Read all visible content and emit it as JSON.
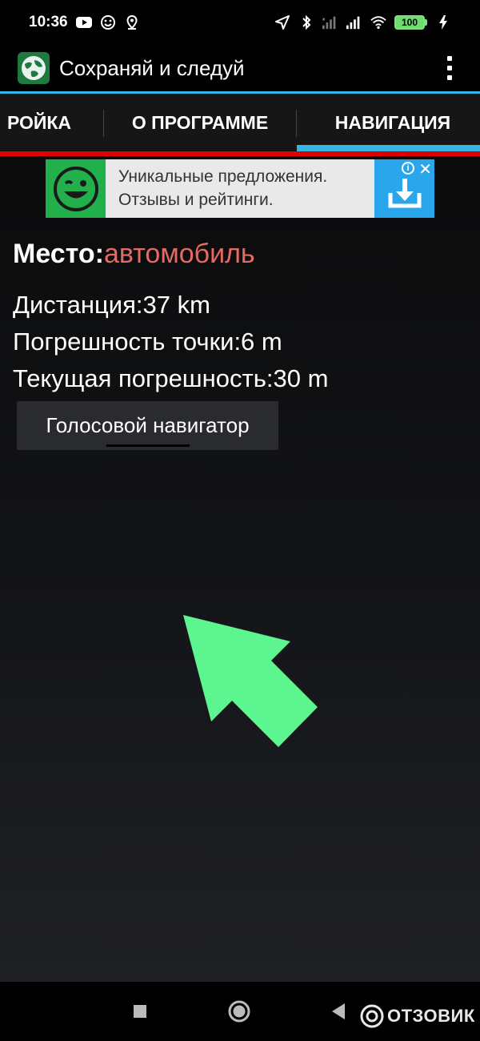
{
  "status_bar": {
    "time": "10:36",
    "battery": "100"
  },
  "app": {
    "title": "Сохраняй и следуй"
  },
  "tabs": [
    {
      "label": "РОЙКА"
    },
    {
      "label": "О ПРОГРАММЕ"
    },
    {
      "label": "НАВИГАЦИЯ",
      "selected": true
    }
  ],
  "ad": {
    "line1": "Уникальные предложения.",
    "line2": "Отзывы и рейтинги."
  },
  "place": {
    "label": "Место:",
    "value": "автомобиль"
  },
  "info": {
    "distance": "Дистанция:37 km",
    "point_error": "Погрешность точки:6 m",
    "current_error": "Текущая погрешность:30 m"
  },
  "voice_button": {
    "label": "Голосовой навигатор"
  },
  "watermark": {
    "text": "ОТЗОВИК"
  },
  "colors": {
    "accent": "#33b5e5",
    "arrow": "#5cf590",
    "place_value": "#e46a62",
    "tab_red": "#e00000"
  }
}
